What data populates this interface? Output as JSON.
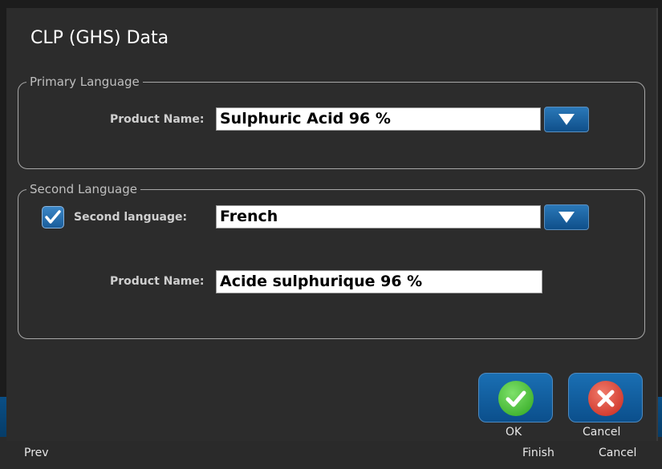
{
  "dialog": {
    "title": "CLP (GHS) Data"
  },
  "primary": {
    "legend": "Primary Language",
    "product_label": "Product Name:",
    "product_value": "Sulphuric Acid 96 %"
  },
  "second": {
    "legend": "Second Language",
    "checkbox_label": "Second language:",
    "checkbox_checked": true,
    "language_value": "French",
    "product_label": "Product Name:",
    "product_value": "Acide sulphurique 96 %"
  },
  "buttons": {
    "ok_label": "OK",
    "cancel_label": "Cancel"
  },
  "bottom_bar": {
    "prev": "Prev",
    "finish": "Finish",
    "cancel": "Cancel"
  },
  "colors": {
    "ok_green": "#3cbf2f",
    "cancel_red": "#d83a2e",
    "accent_blue": "#1a6fb3"
  }
}
